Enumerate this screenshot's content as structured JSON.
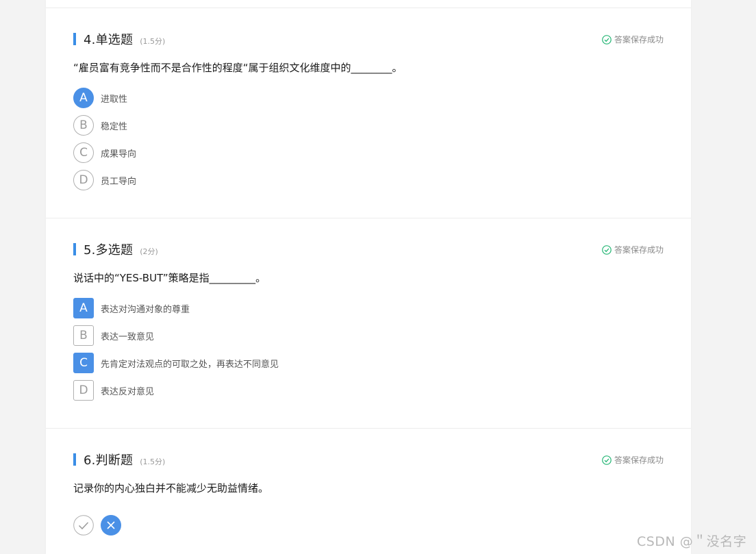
{
  "colors": {
    "accent": "#4a90e6",
    "success": "#22b573",
    "muted": "#8a8a8a"
  },
  "questions": [
    {
      "title": "4.单选题",
      "score": "(1.5分)",
      "status": "答案保存成功",
      "text": "“雇员富有竞争性而不是合作性的程度“属于组织文化维度中的________。",
      "type": "single",
      "options": [
        {
          "letter": "A",
          "label": "进取性",
          "selected": true
        },
        {
          "letter": "B",
          "label": "稳定性",
          "selected": false
        },
        {
          "letter": "C",
          "label": "成果导向",
          "selected": false
        },
        {
          "letter": "D",
          "label": "员工导向",
          "selected": false
        }
      ]
    },
    {
      "title": "5.多选题",
      "score": "(2分)",
      "status": "答案保存成功",
      "text": "说话中的“YES-BUT”策略是指_________。",
      "type": "multiple",
      "options": [
        {
          "letter": "A",
          "label": "表达对沟通对象的尊重",
          "selected": true
        },
        {
          "letter": "B",
          "label": "表达一致意见",
          "selected": false
        },
        {
          "letter": "C",
          "label": "先肯定对法观点的可取之处，再表达不同意见",
          "selected": true
        },
        {
          "letter": "D",
          "label": "表达反对意见",
          "selected": false
        }
      ]
    },
    {
      "title": "6.判断题",
      "score": "(1.5分)",
      "status": "答案保存成功",
      "text": "记录你的内心独白并不能减少无助益情绪。",
      "type": "judge",
      "options": [
        {
          "icon": "check-icon",
          "selected": false
        },
        {
          "icon": "cross-icon",
          "selected": true
        }
      ]
    }
  ],
  "watermark": "CSDN @＂没名字"
}
